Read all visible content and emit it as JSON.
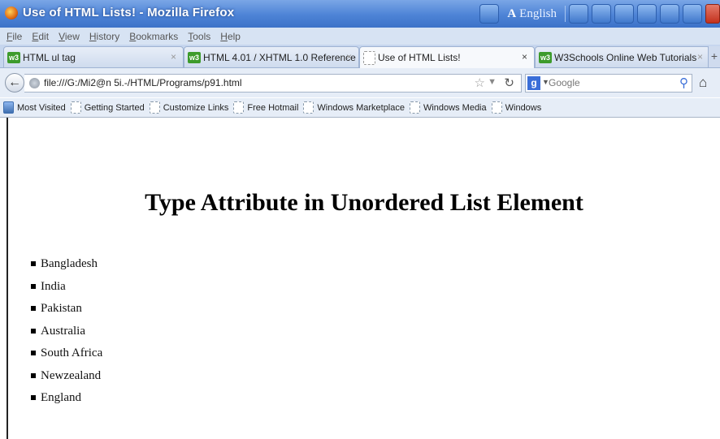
{
  "window": {
    "title": "Use of HTML Lists! - Mozilla Firefox",
    "language": "English"
  },
  "menu": [
    "File",
    "Edit",
    "View",
    "History",
    "Bookmarks",
    "Tools",
    "Help"
  ],
  "tabs": [
    {
      "label": "HTML ul tag",
      "active": false
    },
    {
      "label": "HTML 4.01 / XHTML 1.0 Reference",
      "active": false
    },
    {
      "label": "Use of HTML Lists!",
      "active": true
    },
    {
      "label": "W3Schools Online Web Tutorials",
      "active": false
    }
  ],
  "navbar": {
    "url": "file:///G:/Mi2@n 5i.-/HTML/Programs/p91.html",
    "search_engine": "Google",
    "search_placeholder": "Google"
  },
  "bookmarks": [
    "Most Visited",
    "Getting Started",
    "Customize Links",
    "Free Hotmail",
    "Windows Marketplace",
    "Windows Media",
    "Windows"
  ],
  "page": {
    "heading": "Type Attribute in Unordered List Element",
    "items": [
      "Bangladesh",
      "India",
      "Pakistan",
      "Australia",
      "South Africa",
      "Newzealand",
      "England"
    ]
  }
}
